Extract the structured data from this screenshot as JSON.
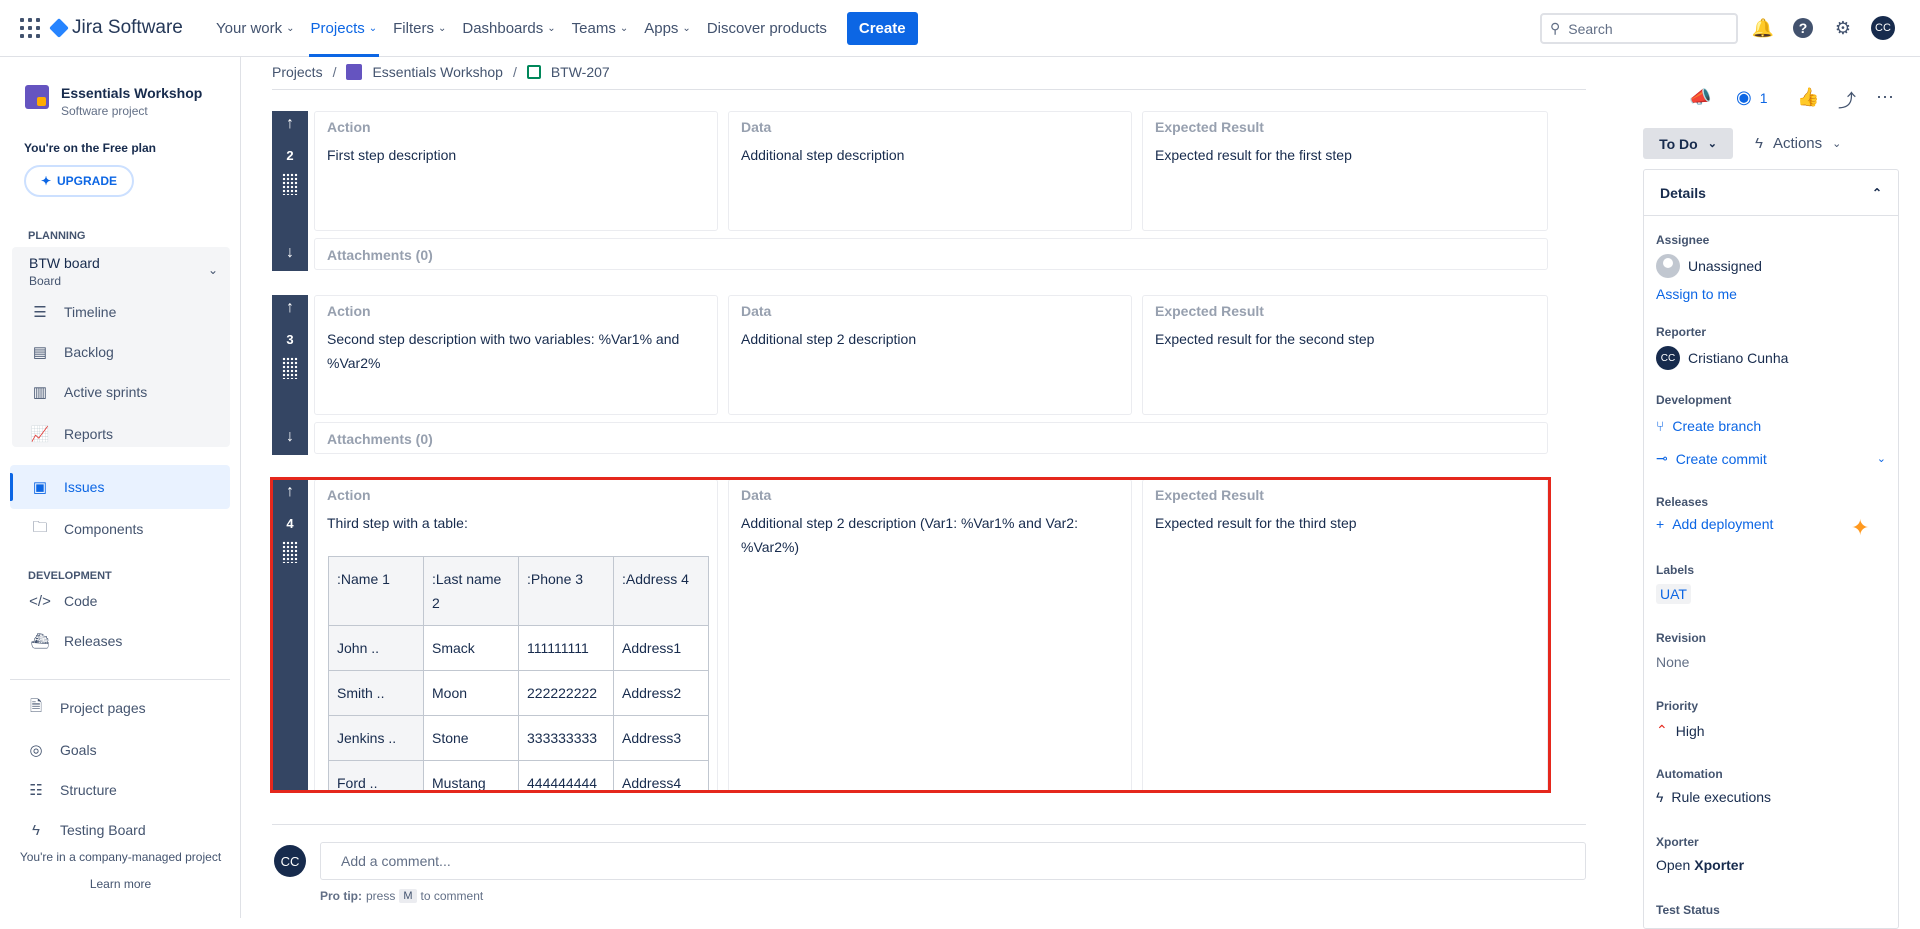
{
  "topnav": {
    "brand": "Jira Software",
    "items": [
      {
        "label": "Your work",
        "caret": true
      },
      {
        "label": "Projects",
        "caret": true,
        "active": true
      },
      {
        "label": "Filters",
        "caret": true
      },
      {
        "label": "Dashboards",
        "caret": true
      },
      {
        "label": "Teams",
        "caret": true
      },
      {
        "label": "Apps",
        "caret": true
      },
      {
        "label": "Discover products",
        "caret": false
      }
    ],
    "create_label": "Create",
    "search_placeholder": "Search",
    "user_initials": "CC",
    "accent": "#0c66e4"
  },
  "sidebar": {
    "project_name": "Essentials Workshop",
    "project_type": "Software project",
    "plan_text": "You're on the Free plan",
    "upgrade_label": "UPGRADE",
    "planning_label": "PLANNING",
    "board_name": "BTW board",
    "board_type": "Board",
    "planning_items": [
      "Timeline",
      "Backlog",
      "Active sprints",
      "Reports"
    ],
    "issues_label": "Issues",
    "components_label": "Components",
    "development_label": "DEVELOPMENT",
    "dev_items": [
      "Code",
      "Releases"
    ],
    "other_items": [
      "Project pages",
      "Goals",
      "Structure",
      "Testing Board"
    ],
    "footer_text": "You're in a company-managed project",
    "learn_more": "Learn more"
  },
  "breadcrumb": {
    "root": "Projects",
    "project": "Essentials Workshop",
    "issue": "BTW-207"
  },
  "steps": {
    "headers": {
      "action": "Action",
      "data": "Data",
      "expected": "Expected Result"
    },
    "attachments_label": "Attachments (0)",
    "list": [
      {
        "number": "2",
        "action": "First step description",
        "data": "Additional step description",
        "expected": "Expected result for the first step"
      },
      {
        "number": "3",
        "action": "Second step description with two variables: %Var1% and %Var2%",
        "data": "Additional step 2 description",
        "expected": "Expected result for the second step"
      },
      {
        "number": "4",
        "action": "Third step with a table:",
        "data": "Additional step 2 description (Var1: %Var1% and Var2: %Var2%)",
        "expected": "Expected result for the third step"
      }
    ],
    "table": {
      "headers": [
        ":Name 1",
        ":Last name 2",
        ":Phone 3",
        ":Address 4"
      ],
      "rows": [
        [
          "John ..",
          "Smack",
          "111111111",
          "Address1"
        ],
        [
          "Smith ..",
          "Moon",
          "222222222",
          "Address2"
        ],
        [
          "Jenkins ..",
          "Stone",
          "333333333",
          "Address3"
        ],
        [
          "Ford ..",
          "Mustang",
          "444444444",
          "Address4"
        ]
      ]
    },
    "highlight_color": "#e5281d"
  },
  "comment": {
    "avatar_initials": "CC",
    "placeholder": "Add a comment...",
    "protip_label": "Pro tip:",
    "protip_press": "press",
    "protip_key": "M",
    "protip_end": "to comment"
  },
  "right_panel": {
    "watch_count": "1",
    "status": "To Do",
    "actions_label": "Actions",
    "details_title": "Details",
    "fields": {
      "assignee_label": "Assignee",
      "assignee_value": "Unassigned",
      "assign_to_me": "Assign to me",
      "reporter_label": "Reporter",
      "reporter_initials": "CC",
      "reporter_value": "Cristiano Cunha",
      "development_label": "Development",
      "create_branch": "Create branch",
      "create_commit": "Create commit",
      "releases_label": "Releases",
      "add_deployment": "Add deployment",
      "labels_label": "Labels",
      "labels_value": "UAT",
      "revision_label": "Revision",
      "revision_value": "None",
      "priority_label": "Priority",
      "priority_value": "High",
      "automation_label": "Automation",
      "automation_value": "Rule executions",
      "xporter_label": "Xporter",
      "xporter_open": "Open",
      "xporter_name": "Xporter",
      "test_status_label": "Test Status"
    }
  }
}
